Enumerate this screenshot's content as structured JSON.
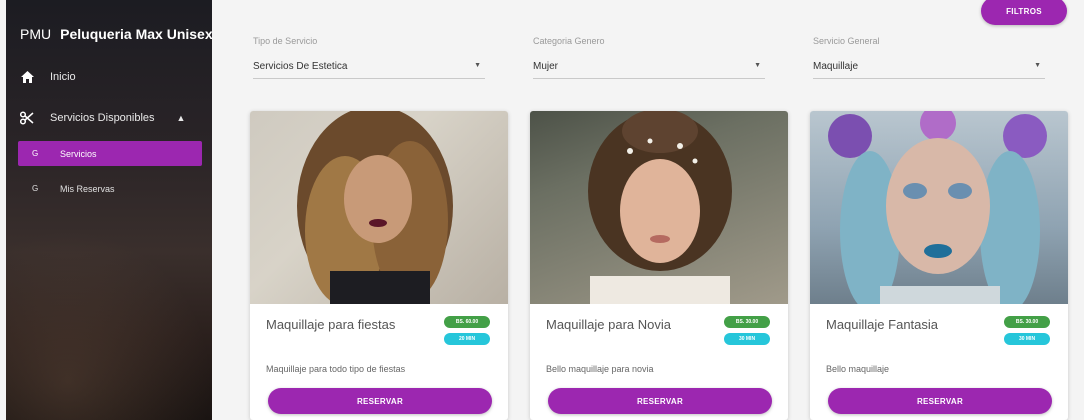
{
  "sidebar": {
    "brand_abbr": "PMU",
    "brand_name": "Peluqueria Max Unisex",
    "items": [
      {
        "label": "Inicio",
        "icon": "home-icon"
      },
      {
        "label": "Servicios Disponibles",
        "icon": "scissors-icon",
        "caret": "▲"
      }
    ],
    "subitems": [
      {
        "label": "Servicios",
        "marker": "G",
        "active": true
      },
      {
        "label": "Mis Reservas",
        "marker": "G",
        "active": false
      }
    ]
  },
  "filters": {
    "button_label": "FILTROS",
    "fields": [
      {
        "label": "Tipo de Servicio",
        "value": "Servicios De Estetica"
      },
      {
        "label": "Categoria Genero",
        "value": "Mujer"
      },
      {
        "label": "Servicio General",
        "value": "Maquillaje"
      }
    ]
  },
  "cards": [
    {
      "title": "Maquillaje para fiestas",
      "price": "BS. 60.00",
      "time": "20 MIN",
      "description": "Maquillaje para todo tipo de fiestas",
      "button": "RESERVAR"
    },
    {
      "title": "Maquillaje para Novia",
      "price": "BS. 30.00",
      "time": "30 MIN",
      "description": "Bello maquillaje para novia",
      "button": "RESERVAR"
    },
    {
      "title": "Maquillaje Fantasia",
      "price": "BS. 30.00",
      "time": "30 MIN",
      "description": "Bello maquillaje",
      "button": "RESERVAR"
    }
  ],
  "colors": {
    "accent": "#9c27b0",
    "price_badge": "#43a047",
    "time_badge": "#26c6da"
  }
}
